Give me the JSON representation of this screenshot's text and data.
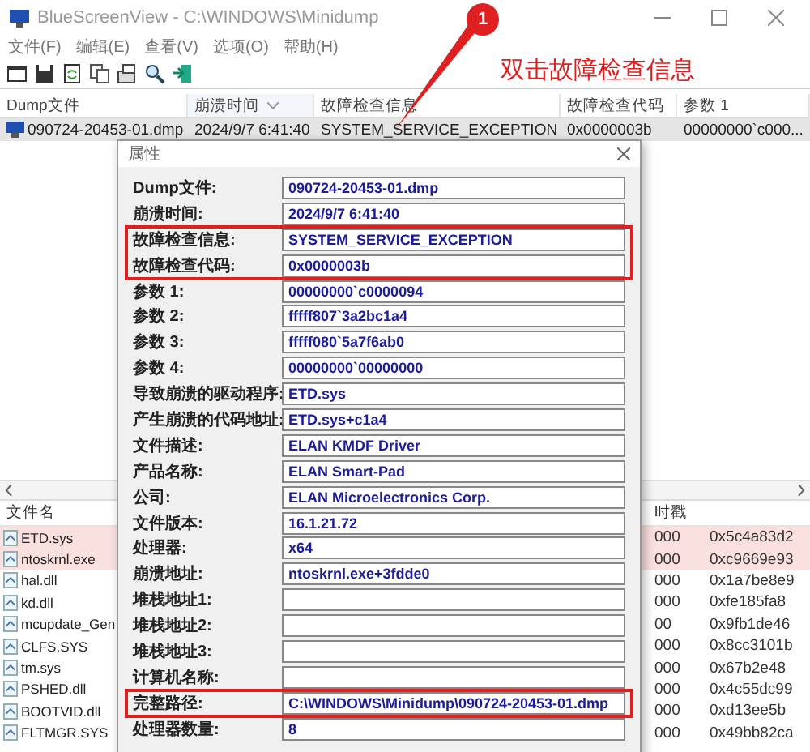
{
  "window": {
    "title": "BlueScreenView - C:\\WINDOWS\\Minidump"
  },
  "menu": [
    "文件(F)",
    "编辑(E)",
    "查看(V)",
    "选项(O)",
    "帮助(H)"
  ],
  "crash_list": {
    "columns": [
      {
        "label": "Dump文件",
        "sorted": false
      },
      {
        "label": "崩溃时间",
        "sorted": true
      },
      {
        "label": "故障检查信息",
        "sorted": false
      },
      {
        "label": "故障检查代码",
        "sorted": false
      },
      {
        "label": "参数 1",
        "sorted": false
      }
    ],
    "rows": [
      {
        "selected": true,
        "cells": [
          "090724-20453-01.dmp",
          "2024/9/7 6:41:40",
          "SYSTEM_SERVICE_EXCEPTION",
          "0x0000003b",
          "00000000`c000..."
        ]
      }
    ]
  },
  "lower_list": {
    "columns": [
      "文件名",
      "时戳"
    ],
    "rows": [
      {
        "name": "ETD.sys",
        "column_2": "000",
        "timestamp": "0x5c4a83d2",
        "highlighted": true
      },
      {
        "name": "ntoskrnl.exe",
        "column_2": "000",
        "timestamp": "0xc9669e93",
        "highlighted": true
      },
      {
        "name": "hal.dll",
        "column_2": "000",
        "timestamp": "0x1a7be8e9",
        "highlighted": false
      },
      {
        "name": "kd.dll",
        "column_2": "000",
        "timestamp": "0xfe185fa8",
        "highlighted": false
      },
      {
        "name": "mcupdate_Gen",
        "column_2": "00",
        "timestamp": "0x9fb1de46",
        "highlighted": false
      },
      {
        "name": "CLFS.SYS",
        "column_2": "000",
        "timestamp": "0x8cc3101b",
        "highlighted": false
      },
      {
        "name": "tm.sys",
        "column_2": "000",
        "timestamp": "0x67b2e48",
        "highlighted": false
      },
      {
        "name": "PSHED.dll",
        "column_2": "000",
        "timestamp": "0x4c55dc99",
        "highlighted": false
      },
      {
        "name": "BOOTVID.dll",
        "column_2": "000",
        "timestamp": "0xd13ee5b",
        "highlighted": false
      },
      {
        "name": "FLTMGR.SYS",
        "column_2": "000",
        "timestamp": "0x49bb82ca",
        "highlighted": false
      }
    ]
  },
  "dialog": {
    "title": "属性",
    "groups": [
      {
        "highlighted": false,
        "fields": [
          {
            "label": "Dump文件:",
            "value": "090724-20453-01.dmp"
          },
          {
            "label": "崩溃时间:",
            "value": "2024/9/7 6:41:40"
          }
        ]
      },
      {
        "highlighted": true,
        "fields": [
          {
            "label": "故障检查信息:",
            "value": "SYSTEM_SERVICE_EXCEPTION"
          },
          {
            "label": "故障检查代码:",
            "value": "0x0000003b"
          }
        ]
      },
      {
        "highlighted": false,
        "fields": [
          {
            "label": "参数 1:",
            "value": "00000000`c0000094"
          },
          {
            "label": "参数 2:",
            "value": "fffff807`3a2bc1a4"
          },
          {
            "label": "参数 3:",
            "value": "fffff080`5a7f6ab0"
          },
          {
            "label": "参数 4:",
            "value": "00000000`00000000"
          },
          {
            "label": "导致崩溃的驱动程序:",
            "value": "ETD.sys"
          },
          {
            "label": "产生崩溃的代码地址:",
            "value": "ETD.sys+c1a4"
          },
          {
            "label": "文件描述:",
            "value": "ELAN KMDF Driver"
          },
          {
            "label": "产品名称:",
            "value": "ELAN Smart-Pad"
          },
          {
            "label": "公司:",
            "value": "ELAN Microelectronics Corp."
          },
          {
            "label": "文件版本:",
            "value": "16.1.21.72"
          },
          {
            "label": "处理器:",
            "value": "x64"
          },
          {
            "label": "崩溃地址:",
            "value": "ntoskrnl.exe+3fdde0"
          },
          {
            "label": "堆栈地址1:"
          },
          {
            "label": "堆栈地址2:"
          },
          {
            "label": "堆栈地址3:"
          },
          {
            "label": "计算机名称:"
          }
        ]
      },
      {
        "highlighted": true,
        "fields": [
          {
            "label": "完整路径:",
            "value": "C:\\WINDOWS\\Minidump\\090724-20453-01.dmp"
          }
        ]
      },
      {
        "highlighted": false,
        "fields": [
          {
            "label": "处理器数量:",
            "value": "8"
          }
        ]
      }
    ]
  },
  "annotation": {
    "badge": "1",
    "text": "双击故障检查信息"
  }
}
